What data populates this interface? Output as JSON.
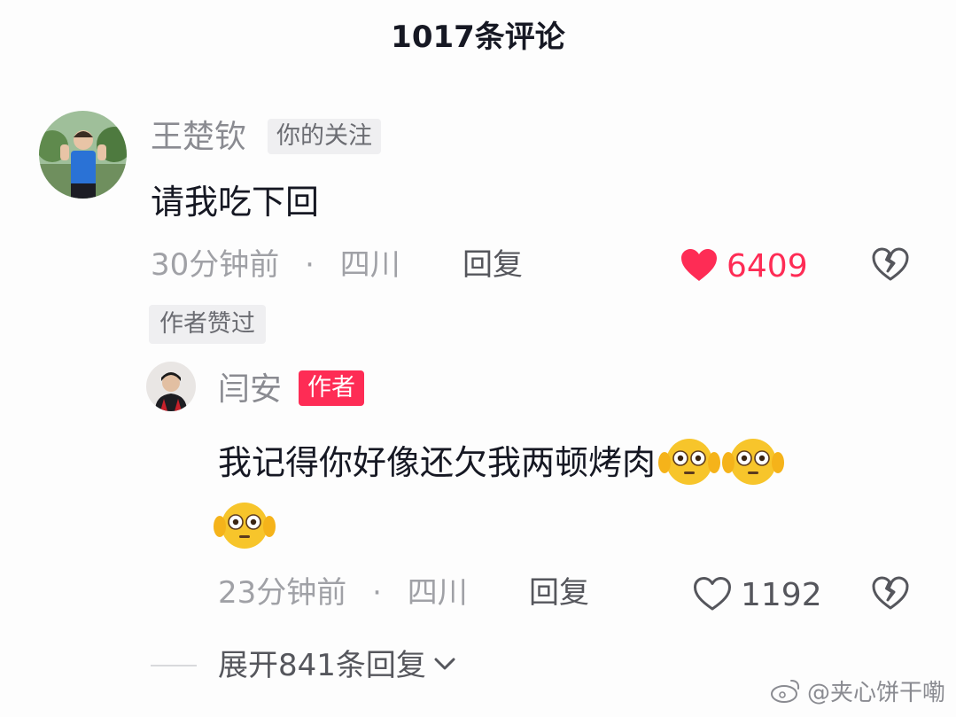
{
  "header": {
    "title": "1017条评论"
  },
  "comment": {
    "username": "王楚钦",
    "follow_tag": "你的关注",
    "text": "请我吃下回",
    "time": "30分钟前",
    "dot": "·",
    "location": "四川",
    "reply_label": "回复",
    "likes": "6409",
    "liked": true,
    "author_liked_badge": "作者赞过"
  },
  "reply": {
    "username": "闫安",
    "author_tag": "作者",
    "text": "我记得你好像还欠我两顿烤肉",
    "emoji_count": 3,
    "time": "23分钟前",
    "dot": "·",
    "location": "四川",
    "reply_label": "回复",
    "likes": "1192",
    "liked": false
  },
  "expand": {
    "label": "展开841条回复"
  },
  "watermark": {
    "text": "@夹心饼干嘞"
  },
  "colors": {
    "accent": "#fe2c55",
    "text": "#161823",
    "muted": "#a0a1a6"
  },
  "icons": [
    "heart-filled-icon",
    "heart-outline-icon",
    "broken-heart-icon",
    "chevron-down-icon",
    "weibo-icon",
    "flushed-emoji-icon"
  ]
}
